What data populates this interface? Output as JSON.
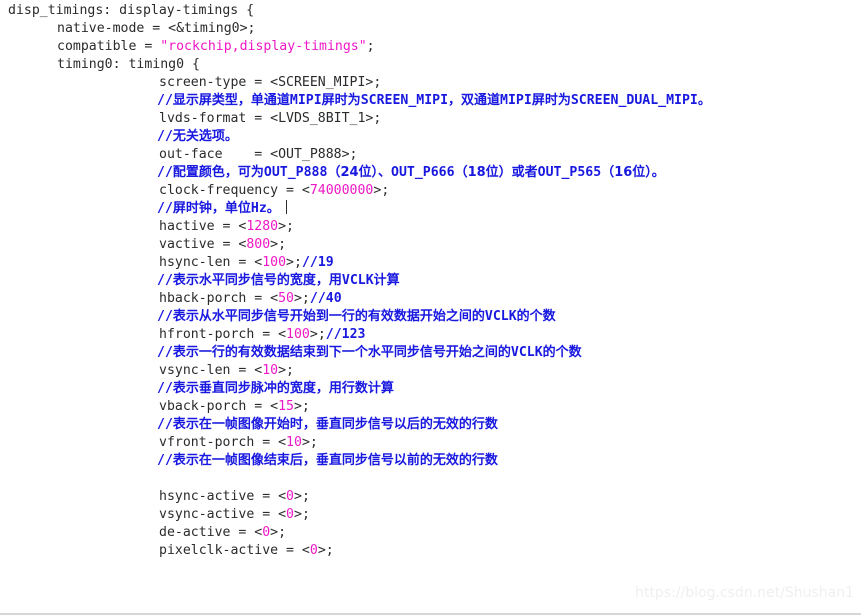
{
  "editor": {
    "background_color": "#ffffff",
    "text_color": "#2b2b2b",
    "comment_color": "#1818e0",
    "literal_color": "#ef18c6",
    "watermark": "https://blog.csdn.net/Shushan1"
  },
  "code": {
    "lines": [
      {
        "indent": 0,
        "type": "code",
        "text": "disp_timings: display-timings {"
      },
      {
        "indent": 1,
        "type": "code",
        "pre": "native-mode = <&timing0>;"
      },
      {
        "indent": 1,
        "type": "code",
        "pre": "compatible = ",
        "str": "\"rockchip,display-timings\"",
        "post": ";"
      },
      {
        "indent": 1,
        "type": "code",
        "pre": "timing0: timing0 {"
      },
      {
        "indent": 2,
        "type": "code",
        "pre": "screen-type = <SCREEN_MIPI>;"
      },
      {
        "indent": 2,
        "type": "comment",
        "ascii_head": "//",
        "cjk1": "显示屏类型，单通道",
        "ascii1": "MIPI",
        "cjk2": "屏时为",
        "ascii2": "SCREEN_MIPI",
        "cjk3": "，双通道",
        "ascii3": "MIPI",
        "cjk4": "屏时为",
        "ascii4": "SCREEN_DUAL_MIPI",
        "cjk5": "。"
      },
      {
        "indent": 2,
        "type": "code",
        "pre": "lvds-format = <LVDS_8BIT_1>;"
      },
      {
        "indent": 2,
        "type": "comment",
        "ascii_head": "//",
        "cjk1": "无关选项。"
      },
      {
        "indent": 2,
        "type": "code",
        "pre": "out-face    = <OUT_P888>;"
      },
      {
        "indent": 2,
        "type": "comment",
        "ascii_head": "//",
        "cjk1": "配置颜色，可为",
        "ascii1": "OUT_P888",
        "cjk2": "（24位）、",
        "ascii2": "OUT_P666",
        "cjk3": "（18位）或者",
        "ascii3": "OUT_P565",
        "cjk4": "（16位）。"
      },
      {
        "indent": 2,
        "type": "code",
        "pre": "clock-frequency = <",
        "num": "74000000",
        "post": ">;"
      },
      {
        "indent": 2,
        "type": "comment",
        "ascii_head": "//",
        "cjk1": "屏时钟，单位",
        "ascii1": "Hz",
        "cjk2": "。",
        "caret": true
      },
      {
        "indent": 2,
        "type": "code",
        "pre": "hactive = <",
        "num": "1280",
        "post": ">;"
      },
      {
        "indent": 2,
        "type": "code",
        "pre": "vactive = <",
        "num": "800",
        "post": ">;"
      },
      {
        "indent": 2,
        "type": "code",
        "pre": "hsync-len = <",
        "num": "100",
        "post": ">;",
        "trail_comment": "//19"
      },
      {
        "indent": 2,
        "type": "comment",
        "ascii_head": "//",
        "cjk1": "表示水平同步信号的宽度，用",
        "ascii1": "VCLK",
        "cjk2": "计算"
      },
      {
        "indent": 2,
        "type": "code",
        "pre": "hback-porch = <",
        "num": "50",
        "post": ">;",
        "trail_comment": "//40"
      },
      {
        "indent": 2,
        "type": "comment",
        "ascii_head": "//",
        "cjk1": "表示从水平同步信号开始到一行的有效数据开始之间的",
        "ascii1": "VCLK",
        "cjk2": "的个数"
      },
      {
        "indent": 2,
        "type": "code",
        "pre": "hfront-porch = <",
        "num": "100",
        "post": ">;",
        "trail_comment": "//123"
      },
      {
        "indent": 2,
        "type": "comment",
        "ascii_head": "//",
        "cjk1": "表示一行的有效数据结束到下一个水平同步信号开始之间的",
        "ascii1": "VCLK",
        "cjk2": "的个数"
      },
      {
        "indent": 2,
        "type": "code",
        "pre": "vsync-len = <",
        "num": "10",
        "post": ">;"
      },
      {
        "indent": 2,
        "type": "comment",
        "ascii_head": "//",
        "cjk1": "表示垂直同步脉冲的宽度，用行数计算"
      },
      {
        "indent": 2,
        "type": "code",
        "pre": "vback-porch = <",
        "num": "15",
        "post": ">;"
      },
      {
        "indent": 2,
        "type": "comment",
        "ascii_head": "//",
        "cjk1": "表示在一帧图像开始时，垂直同步信号以后的无效的行数"
      },
      {
        "indent": 2,
        "type": "code",
        "pre": "vfront-porch = <",
        "num": "10",
        "post": ">;"
      },
      {
        "indent": 2,
        "type": "comment",
        "ascii_head": "//",
        "cjk1": "表示在一帧图像结束后，垂直同步信号以前的无效的行数"
      },
      {
        "indent": 2,
        "type": "blank"
      },
      {
        "indent": 2,
        "type": "code",
        "pre": "hsync-active = <",
        "num": "0",
        "post": ">;"
      },
      {
        "indent": 2,
        "type": "code",
        "pre": "vsync-active = <",
        "num": "0",
        "post": ">;"
      },
      {
        "indent": 2,
        "type": "code",
        "pre": "de-active = <",
        "num": "0",
        "post": ">;"
      },
      {
        "indent": 2,
        "type": "code",
        "pre": "pixelclk-active = <",
        "num": "0",
        "post": ">;",
        "clipped": true
      }
    ]
  }
}
